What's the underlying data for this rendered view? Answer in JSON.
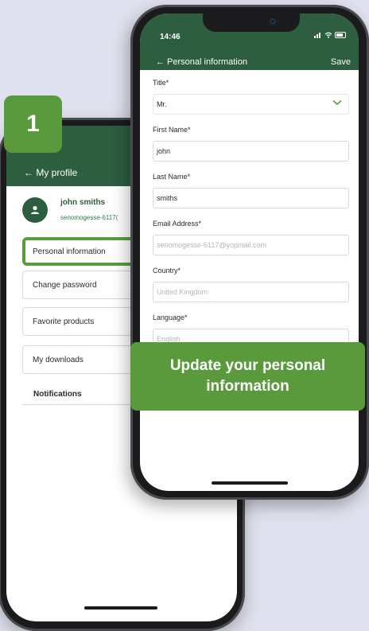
{
  "back_screen": {
    "header_title": "← My profile",
    "user": {
      "name": "john smiths",
      "email": "senomogesse-6117("
    },
    "menu": [
      {
        "label": "Personal information"
      },
      {
        "label": "Change password"
      },
      {
        "label": "Favorite products"
      },
      {
        "label": "My downloads"
      }
    ],
    "notifications_label": "Notifications"
  },
  "front_screen": {
    "status_time": "14:46",
    "header_title": "← Personal information",
    "save_label": "Save",
    "fields": {
      "title": {
        "label": "Title*",
        "value": "Mr."
      },
      "first_name": {
        "label": "First Name*",
        "value": "john"
      },
      "last_name": {
        "label": "Last Name*",
        "value": "smiths"
      },
      "email": {
        "label": "Email Address*",
        "value": "senomogesse-6117@yopmail.com"
      },
      "country": {
        "label": "Country*",
        "value": "United Kingdom"
      },
      "language": {
        "label": "Language*",
        "value": "English"
      }
    }
  },
  "step_badge": "1",
  "banner_text": "Update your personal information",
  "colors": {
    "header_green": "#2c5e3f",
    "accent_green": "#5a9a3c",
    "background": "#dfe1ee"
  },
  "icons": [
    "user-icon",
    "chevron-down-icon",
    "signal-icon",
    "wifi-icon",
    "battery-icon"
  ]
}
